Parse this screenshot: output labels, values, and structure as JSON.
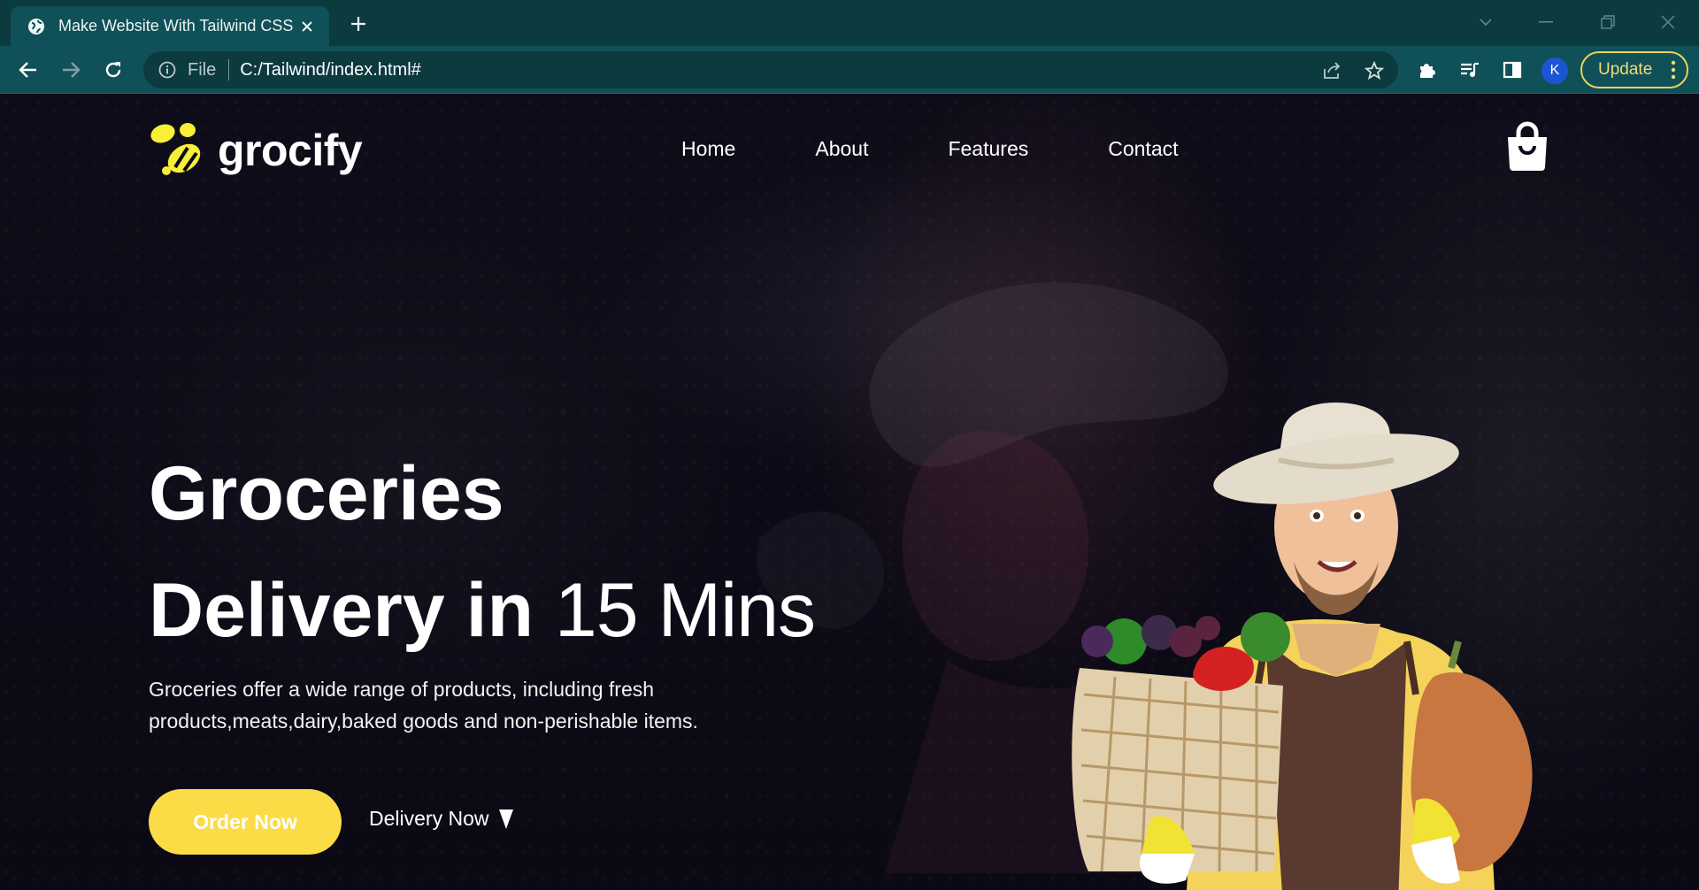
{
  "browser": {
    "tab_title": "Make Website With Tailwind CSS",
    "omnibox_scheme": "File",
    "url": "C:/Tailwind/index.html#",
    "profile_initial": "K",
    "update_label": "Update"
  },
  "site": {
    "logo_text": "grocify",
    "nav": [
      "Home",
      "About",
      "Features",
      "Contact"
    ],
    "hero": {
      "title_line1": "Groceries",
      "title_line2_bold": "Delivery in",
      "title_line2_light": "15 Mins",
      "description": "Groceries offer a wide range of products, including fresh products,meats,dairy,baked goods and non-perishable items.",
      "order_button": "Order Now",
      "delivery_link": "Delivery Now"
    }
  },
  "colors": {
    "accent": "#fbdc47",
    "chrome_dark": "#0b3a3f",
    "chrome": "#105058",
    "page_bg": "#0c0a16"
  },
  "icons": {
    "tab": "globe-icon",
    "nav": [
      "back-icon",
      "forward-icon",
      "reload-icon"
    ],
    "omnibox": [
      "info-icon",
      "share-icon",
      "star-icon"
    ],
    "toolbar": [
      "puzzle-icon",
      "media-icon",
      "sidepanel-icon"
    ],
    "site": [
      "bee-logo-icon",
      "shopping-bag-icon",
      "cursor-icon"
    ]
  }
}
